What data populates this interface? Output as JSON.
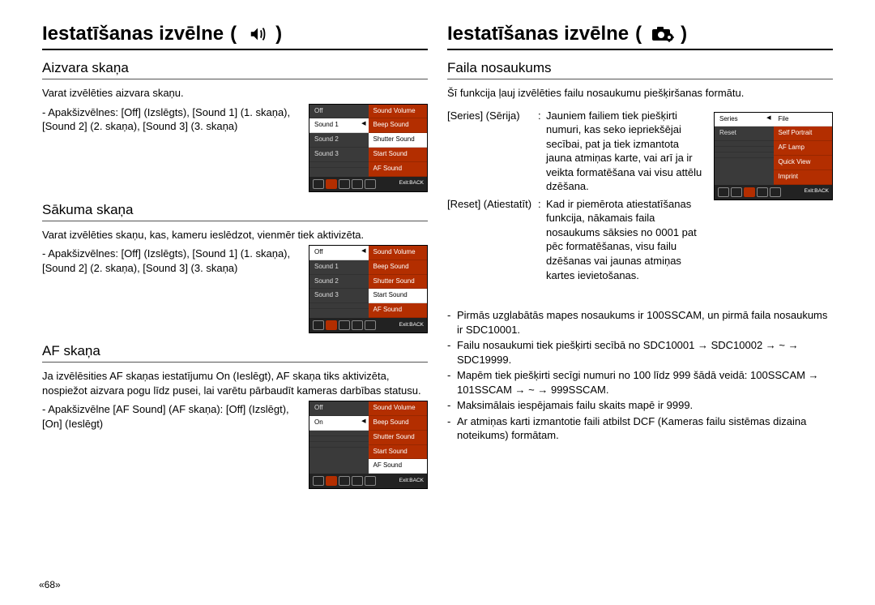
{
  "pageNumber": "«68»",
  "left": {
    "title": "Iestatīšanas izvēlne",
    "sec1": {
      "heading": "Aizvara skaņa",
      "intro": "Varat izvēlēties aizvara skaņu.",
      "sub": "- Apakšizvēlnes: [Off] (Izslēgts), [Sound 1] (1. skaņa), [Sound 2] (2. skaņa), [Sound 3] (3. skaņa)",
      "menuLeft": [
        "Off",
        "Sound 1",
        "Sound 2",
        "Sound 3",
        ""
      ],
      "menuRight": [
        "Sound Volume",
        "Beep Sound",
        "Shutter Sound",
        "Start Sound",
        "AF Sound"
      ],
      "menuSel": 1,
      "menuHl": 2,
      "exit": "Exit:BACK"
    },
    "sec2": {
      "heading": "Sākuma skaņa",
      "intro": "Varat izvēlēties skaņu, kas, kameru ieslēdzot, vienmēr tiek aktivizēta.",
      "sub": "- Apakšizvēlnes: [Off] (Izslēgts), [Sound 1] (1. skaņa), [Sound 2] (2. skaņa), [Sound 3] (3. skaņa)",
      "menuLeft": [
        "Off",
        "Sound 1",
        "Sound 2",
        "Sound 3",
        ""
      ],
      "menuRight": [
        "Sound Volume",
        "Beep Sound",
        "Shutter Sound",
        "Start Sound",
        "AF Sound"
      ],
      "menuSel": 0,
      "menuHl": 3,
      "exit": "Exit:BACK"
    },
    "sec3": {
      "heading": "AF skaņa",
      "intro": "Ja izvēlēsities AF skaņas iestatījumu On (Ieslēgt), AF skaņa tiks aktivizēta, nospiežot aizvara pogu līdz pusei, lai varētu pārbaudīt kameras darbības statusu.",
      "sub": "- Apakšizvēlne [AF Sound] (AF skaņa): [Off] (Izslēgt), [On] (Ieslēgt)",
      "menuLeft": [
        "Off",
        "On",
        "",
        "",
        ""
      ],
      "menuRight": [
        "Sound Volume",
        "Beep Sound",
        "Shutter Sound",
        "Start Sound",
        "AF Sound"
      ],
      "menuSel": 1,
      "menuHl": 4,
      "exit": "Exit:BACK"
    }
  },
  "right": {
    "title": "Iestatīšanas izvēlne",
    "sec1": {
      "heading": "Faila nosaukums",
      "intro": "Šī funkcija ļauj izvēlēties failu nosaukumu piešķiršanas formātu.",
      "defs": [
        {
          "term": "[Series] (Sērija)",
          "desc": "Jauniem failiem tiek piešķirti numuri, kas seko iepriekšējai secībai, pat ja tiek izmantota jauna atmiņas karte, vai arī ja ir veikta formatēšana vai visu attēlu dzēšana."
        },
        {
          "term": "[Reset] (Atiestatīt)",
          "desc": "Kad ir piemērota atiestatīšanas funkcija, nākamais faila nosaukums sāksies no 0001 pat pēc formatēšanas, visu failu dzēšanas vai jaunas atmiņas kartes ievietošanas."
        }
      ],
      "menuLeft": [
        "Series",
        "Reset",
        "",
        "",
        ""
      ],
      "menuRight": [
        "File",
        "Self Portrait",
        "AF Lamp",
        "Quick View",
        "Imprint"
      ],
      "menuSel": 0,
      "menuHl": 0,
      "exit": "Exit:BACK"
    },
    "bullets": [
      "Pirmās uzglabātās mapes nosaukums ir 100SSCAM, un pirmā faila nosaukums ir SDC10001.",
      "Failu nosaukumi tiek piešķirti secībā no SDC10001 → SDC10002 → ~ → SDC19999.",
      "Mapēm tiek piešķirti secīgi numuri no 100 līdz 999 šādā veidā: 100SSCAM → 101SSCAM → ~ → 999SSCAM.",
      "Maksimālais iespējamais failu skaits mapē ir 9999.",
      "Ar atmiņas karti izmantotie faili atbilst DCF (Kameras failu sistēmas dizaina noteikums) formātam."
    ]
  }
}
